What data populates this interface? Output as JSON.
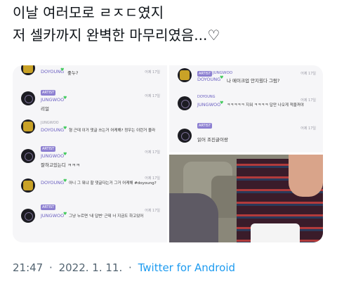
{
  "tweet": {
    "line1": "이날 여러모로 ㄹㅈㄷ였지",
    "line2": "저 셀카까지 완벽한 마무리였음...♡"
  },
  "left_panel": [
    {
      "author": "DOYOUNG",
      "message": "좋누?",
      "time": "어제 17일",
      "avatar": "gold"
    },
    {
      "badge": "ARTIST",
      "author": "JUNGWOO",
      "message": "리얼",
      "time": "어제 17일",
      "avatar": "dark"
    },
    {
      "author": "DOYOUNG",
      "message": "형 근데 이거 댓글 쓰는거 어케해? 정우는 이런거 몰라",
      "time": "어제 17일",
      "avatar": "gold"
    },
    {
      "badge": "ARTIST",
      "author": "JUNGWOO",
      "message": "잘하고있는디 ㅋㅋㅋ",
      "time": "어제 17일",
      "avatar": "dark"
    },
    {
      "author": "DOYOUNG",
      "message": "아니 그 뭐냐 할 댓글다는거 그거 어케해 #doyoung?",
      "time": "어제 17일",
      "avatar": "gold"
    },
    {
      "badge": "ARTIST",
      "author": "JUNGWOO",
      "message": "그냥 누르면 '내 답변' 근데 너 지금도 하고있어",
      "time": "어제 17일",
      "avatar": "dark"
    }
  ],
  "right_panel": [
    {
      "badge": "ARTIST",
      "author": "JUNGWOO",
      "message": "",
      "time": "어제 17일",
      "avatar": "gold"
    },
    {
      "author": "DOYOUNG",
      "message": "나 메이크업 안지웠다 그럼?",
      "time": "어제 17일",
      "avatar": "gold"
    },
    {
      "author": "DOYOUNG",
      "message": "",
      "time": "어제 17일",
      "avatar": "dark"
    },
    {
      "author": "JUNGWOO",
      "message": "ㅋㅋㅋㅋㅋ 지워 ㅋㅋㅋㅋ 답만 나오게 적을꺼야",
      "time": "어제 17일",
      "avatar": "dark"
    },
    {
      "badge": "ARTIST",
      "author": "",
      "message": "",
      "time": "어제 17일",
      "avatar": "dark"
    },
    {
      "author": "",
      "message": "읽어 조진글이랑",
      "time": "",
      "avatar": "dark"
    }
  ],
  "meta": {
    "time": "21:47",
    "date": "2022. 1. 11.",
    "separator": "·",
    "client": "Twitter for Android"
  }
}
